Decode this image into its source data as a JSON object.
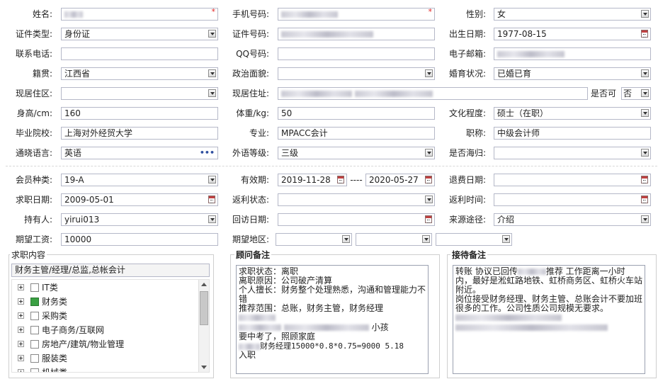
{
  "row1": {
    "name_label": "姓名:",
    "phone_label": "手机号码:",
    "gender_label": "性别:",
    "gender_value": "女"
  },
  "row2": {
    "idtype_label": "证件类型:",
    "idtype_value": "身份证",
    "idno_label": "证件号码:",
    "birth_label": "出生日期:",
    "birth_value": "1977-08-15"
  },
  "row3": {
    "tel_label": "联系电话:",
    "qq_label": "QQ号码:",
    "email_label": "电子邮箱:"
  },
  "row4": {
    "native_label": "籍贯:",
    "native_value": "江西省",
    "political_label": "政治面貌:",
    "marital_label": "婚育状况:",
    "marital_value": "已婚已育"
  },
  "row5": {
    "district_label": "现居住区:",
    "address_label": "现居住址:",
    "flag_label": "是否可",
    "flag_value": "否"
  },
  "row6": {
    "height_label": "身高/cm:",
    "height_value": "160",
    "weight_label": "体重/kg:",
    "weight_value": "50",
    "edu_label": "文化程度:",
    "edu_value": "硕士（在职）"
  },
  "row7": {
    "school_label": "毕业院校:",
    "school_value": "上海对外经贸大学",
    "major_label": "专业:",
    "major_value": "MPACC会计",
    "title_label": "职称:",
    "title_value": "中级会计师"
  },
  "row8": {
    "lang_label": "通晓语言:",
    "lang_value": "英语",
    "lang_more": "•••",
    "level_label": "外语等级:",
    "level_value": "三级",
    "overseas_label": "是否海归:"
  },
  "row9": {
    "member_label": "会员种类:",
    "member_value": "19-A",
    "valid_label": "有效期:",
    "valid_from": "2019-11-28",
    "valid_sep": "----",
    "valid_to": "2020-05-27",
    "refund_label": "退费日期:"
  },
  "row10": {
    "jobdate_label": "求职日期:",
    "jobdate_value": "2009-05-01",
    "rebate_label": "返利状态:",
    "rebatetime_label": "返利时间:"
  },
  "row11": {
    "holder_label": "持有人:",
    "holder_value": "yirui013",
    "revisit_label": "回访日期:",
    "source_label": "来源途径:",
    "source_value": "介绍"
  },
  "row12": {
    "salary_label": "期望工资:",
    "salary_value": "10000",
    "region_label": "期望地区:"
  },
  "job": {
    "title": "求职内容",
    "selected": "财务主管/经理/总监,总帐会计",
    "tree": [
      {
        "label": "IT类",
        "checked": false
      },
      {
        "label": "财务类",
        "checked": true
      },
      {
        "label": "采购类",
        "checked": false
      },
      {
        "label": "电子商务/互联网",
        "checked": false
      },
      {
        "label": "房地产/建筑/物业管理",
        "checked": false
      },
      {
        "label": "服装类",
        "checked": false
      },
      {
        "label": "机械类",
        "checked": false
      }
    ]
  },
  "advisor": {
    "title": "顾问备注",
    "l1": "求职状态：离职",
    "l2": "离职原因：公司破产清算",
    "l3": "个人擅长：财务整个处理熟悉，沟通和管理能力不",
    "l4": "错",
    "l5": "推荐范围：总账，财务主管，财务经理",
    "l6_tail": "小孩",
    "l7": "要中考了，照顾家庭",
    "l8": "财务经理15000*0.8*0.75=9000  5.18",
    "l9": "入职"
  },
  "reception": {
    "title": "接待备注",
    "l1_a": "转账 协议已回传",
    "l1_b": "推荐 工作距离一小时",
    "l2": "内，最好是淞虹路地铁、虹桥商务区、虹桥火车站",
    "l3": "附近。",
    "l4": "岗位接受财务经理、财务主管、总账会计不要加班",
    "l5": "很多的工作。公司性质公司规模无要求。"
  },
  "colors": {
    "border": "#b5b8c8",
    "required": "#e02020",
    "checked": "#3aa043"
  }
}
